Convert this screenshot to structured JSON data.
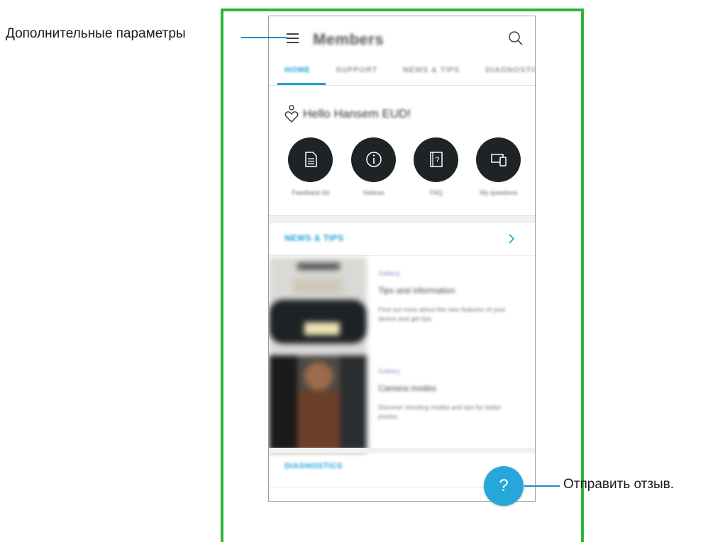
{
  "callouts": {
    "more_options": "Дополнительные параметры",
    "send_feedback": "Отправить отзыв."
  },
  "app": {
    "title": "Members",
    "tabs": [
      "HOME",
      "SUPPORT",
      "NEWS & TIPS",
      "DIAGNOSTICS"
    ],
    "greeting": "Hello Hansem EUD!",
    "quick_actions": [
      {
        "label": "Feedback list",
        "icon": "document-icon"
      },
      {
        "label": "Notices",
        "icon": "info-icon"
      },
      {
        "label": "FAQ",
        "icon": "faq-icon"
      },
      {
        "label": "My questions",
        "icon": "devices-icon"
      }
    ],
    "news_section_title": "NEWS & TIPS",
    "news_items": [
      {
        "tag": "Galaxy",
        "headline": "Tips and information",
        "description": "Find out more about the new features of your device and get tips."
      },
      {
        "tag": "Galaxy",
        "headline": "Camera modes",
        "description": "Discover shooting modes and tips for better photos."
      }
    ],
    "diagnostics_title": "DIAGNOSTICS",
    "fab_label": "?"
  },
  "colors": {
    "accent": "#1da1d9",
    "fab": "#27a7d9",
    "frame": "#2fb43a",
    "callout_line": "#1a8fc6",
    "quick_action_bg": "#1e2326"
  }
}
